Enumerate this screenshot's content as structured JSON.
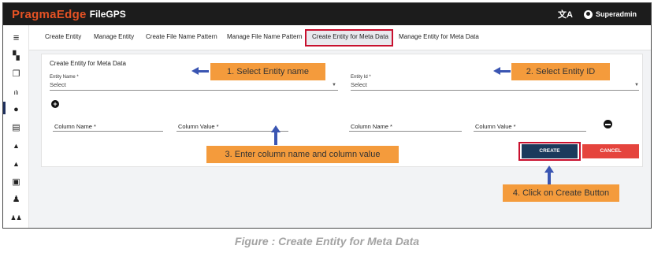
{
  "app": {
    "brand_name": "PragmaEdge",
    "product_name": "FileGPS",
    "user_name": "Superadmin",
    "translate_icon": "translate-icon",
    "user_icon": "account-circle-icon"
  },
  "sidebar": {
    "items": [
      {
        "icon": "menu-icon",
        "glyph": "≡"
      },
      {
        "icon": "dashboard-icon",
        "glyph": "▚"
      },
      {
        "icon": "copy-icon",
        "glyph": "❐"
      },
      {
        "icon": "bar-chart-icon",
        "glyph": "ılı"
      },
      {
        "icon": "account-icon",
        "glyph": "●"
      },
      {
        "icon": "document-icon",
        "glyph": "▤"
      },
      {
        "icon": "alert-icon",
        "glyph": "▲"
      },
      {
        "icon": "notification-icon",
        "glyph": "▲"
      },
      {
        "icon": "settings-box-icon",
        "glyph": "▣"
      },
      {
        "icon": "user-settings-icon",
        "glyph": "♟"
      },
      {
        "icon": "group-icon",
        "glyph": "♟♟"
      }
    ]
  },
  "tabs": [
    {
      "label": "Create Entity"
    },
    {
      "label": "Manage Entity"
    },
    {
      "label": "Create File Name Pattern"
    },
    {
      "label": "Manage File Name Pattern"
    },
    {
      "label": "Create Entity for Meta Data",
      "active": true
    },
    {
      "label": "Manage Entity for Meta Data"
    }
  ],
  "form": {
    "title": "Create Entity for Meta Data",
    "entity_name_label": "Entity Name *",
    "entity_name_value": "Select",
    "entity_id_label": "Entity Id *",
    "entity_id_value": "Select",
    "add_symbol": "+",
    "column_rows": [
      {
        "name_label": "Column Name *",
        "value_label": "Column Value *"
      },
      {
        "name_label": "Column Name *",
        "value_label": "Column Value *"
      }
    ],
    "create_label": "CREATE",
    "cancel_label": "CANCEL"
  },
  "callouts": {
    "step1": "1. Select Entity name",
    "step2": "2. Select Entity ID",
    "step3": "3. Enter column name and column value",
    "step4": "4. Click on Create Button"
  },
  "caption": "Figure : Create Entity for Meta Data",
  "colors": {
    "topbar": "#1c1c1c",
    "brand_orange": "#e55224",
    "highlight_red": "#c8102e",
    "callout_orange": "#f49b3c",
    "arrow_blue": "#3a55b2",
    "create_button": "#1b3a5c",
    "cancel_button": "#e5443d"
  }
}
